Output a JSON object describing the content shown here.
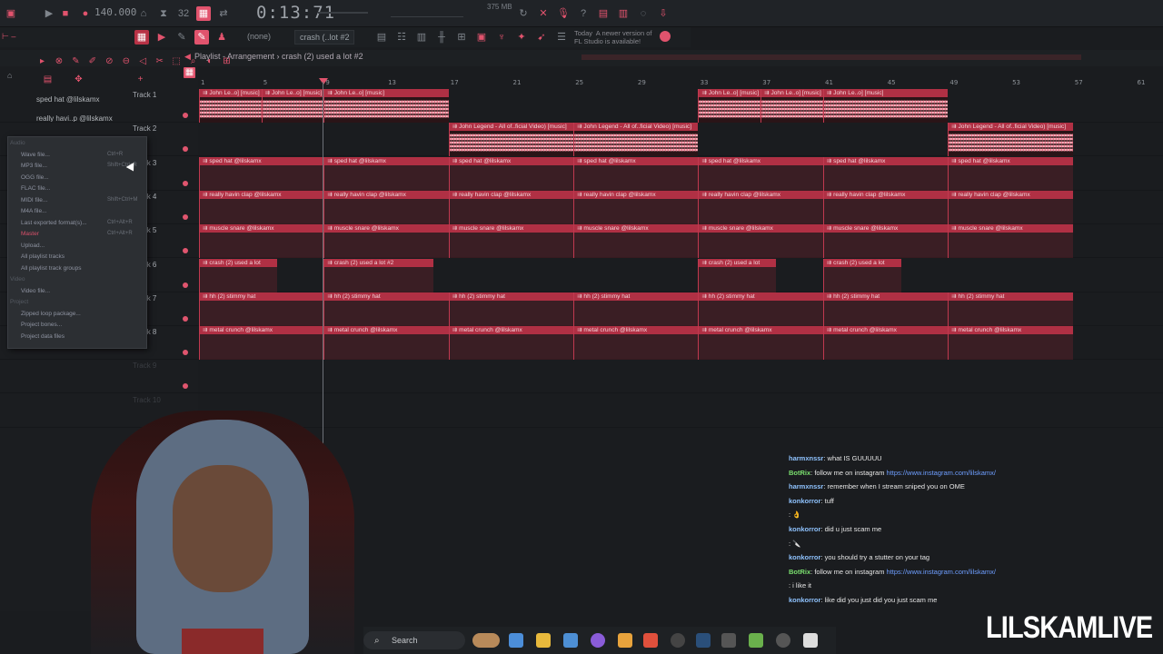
{
  "topbar": {
    "tempo": "140.000",
    "timecode": "0:13:71",
    "memory": "375 MB",
    "none_label": "(none)",
    "pattern_selector": "crash (..lot #2",
    "update_notice": "Today  A newer version of\nFL Studio is available!"
  },
  "playlist": {
    "title": "Playlist - Arrangement › crash (2) used a lot #2"
  },
  "browser": {
    "items": [
      "sped hat @lilskamx",
      "really havi..p @lilskamx"
    ]
  },
  "context_menu": {
    "items": [
      {
        "label": "Audio",
        "shortcut": "",
        "style": "header"
      },
      {
        "label": "Wave file...",
        "shortcut": "Ctrl+R"
      },
      {
        "label": "MP3 file...",
        "shortcut": "Shift+Ctrl+R"
      },
      {
        "label": "OGG file...",
        "shortcut": ""
      },
      {
        "label": "FLAC file...",
        "shortcut": ""
      },
      {
        "label": "MIDI file...",
        "shortcut": "Shift+Ctrl+M"
      },
      {
        "label": "M4A file...",
        "shortcut": ""
      },
      {
        "label": "Last exported format(s)...",
        "shortcut": "Ctrl+Alt+R"
      },
      {
        "label": "Master",
        "shortcut": "Ctrl+Alt+R",
        "style": "pink"
      },
      {
        "label": "Upload...",
        "shortcut": ""
      },
      {
        "label": "All playlist tracks",
        "shortcut": ""
      },
      {
        "label": "All playlist track groups",
        "shortcut": ""
      },
      {
        "label": "Video",
        "shortcut": "",
        "style": "header"
      },
      {
        "label": "Video file...",
        "shortcut": ""
      },
      {
        "label": "Project",
        "shortcut": "",
        "style": "header"
      },
      {
        "label": "Zipped loop package...",
        "shortcut": ""
      },
      {
        "label": "Project bones...",
        "shortcut": ""
      },
      {
        "label": "Project data files",
        "shortcut": ""
      }
    ]
  },
  "ruler": [
    "1",
    "5",
    "9",
    "13",
    "17",
    "21",
    "25",
    "29",
    "33",
    "37",
    "41",
    "45",
    "49",
    "53",
    "57",
    "61"
  ],
  "tracks": [
    {
      "label": "Track 1",
      "clips": [
        {
          "name": "John Le..o] [music]",
          "start": 0,
          "len": 4
        },
        {
          "name": "John Le..o] [music]",
          "start": 4,
          "len": 4
        },
        {
          "name": "John Le..o] [music]",
          "start": 8,
          "len": 8
        },
        {
          "name": "John Le..o] [music]",
          "start": 32,
          "len": 4
        },
        {
          "name": "John Le..o] [music]",
          "start": 36,
          "len": 4
        },
        {
          "name": "John Le..o] [music]",
          "start": 40,
          "len": 8
        }
      ],
      "audio": true
    },
    {
      "label": "Track 2",
      "clips": [
        {
          "name": "John Legend - All of..ficial Video) [music]",
          "start": 16,
          "len": 8
        },
        {
          "name": "John Legend - All of..ficial Video) [music]",
          "start": 24,
          "len": 8
        },
        {
          "name": "John Legend - All of..ficial Video) [music]",
          "start": 48,
          "len": 8
        }
      ],
      "audio": true
    },
    {
      "label": "Track 3",
      "clips": [
        {
          "name": "sped hat @lilskamx",
          "start": 0,
          "len": 8
        },
        {
          "name": "sped hat @lilskamx",
          "start": 8,
          "len": 8
        },
        {
          "name": "sped hat @lilskamx",
          "start": 16,
          "len": 8
        },
        {
          "name": "sped hat @lilskamx",
          "start": 24,
          "len": 8
        },
        {
          "name": "sped hat @lilskamx",
          "start": 32,
          "len": 8
        },
        {
          "name": "sped hat @lilskamx",
          "start": 40,
          "len": 8
        },
        {
          "name": "sped hat @lilskamx",
          "start": 48,
          "len": 8
        }
      ]
    },
    {
      "label": "Track 4",
      "clips": [
        {
          "name": "really havin clap @lilskamx",
          "start": 0,
          "len": 8
        },
        {
          "name": "really havin clap @lilskamx",
          "start": 8,
          "len": 8
        },
        {
          "name": "really havin clap @lilskamx",
          "start": 16,
          "len": 8
        },
        {
          "name": "really havin clap @lilskamx",
          "start": 24,
          "len": 8
        },
        {
          "name": "really havin clap @lilskamx",
          "start": 32,
          "len": 8
        },
        {
          "name": "really havin clap @lilskamx",
          "start": 40,
          "len": 8
        },
        {
          "name": "really havin clap @lilskamx",
          "start": 48,
          "len": 8
        }
      ]
    },
    {
      "label": "Track 5",
      "clips": [
        {
          "name": "muscle snare @lilskamx",
          "start": 0,
          "len": 8
        },
        {
          "name": "muscle snare @lilskamx",
          "start": 8,
          "len": 8
        },
        {
          "name": "muscle snare @lilskamx",
          "start": 16,
          "len": 8
        },
        {
          "name": "muscle snare @lilskamx",
          "start": 24,
          "len": 8
        },
        {
          "name": "muscle snare @lilskamx",
          "start": 32,
          "len": 8
        },
        {
          "name": "muscle snare @lilskamx",
          "start": 40,
          "len": 8
        },
        {
          "name": "muscle snare @lilskamx",
          "start": 48,
          "len": 8
        }
      ]
    },
    {
      "label": "Track 6",
      "clips": [
        {
          "name": "crash (2) used a lot",
          "start": 0,
          "len": 5
        },
        {
          "name": "crash (2) used a lot #2",
          "start": 8,
          "len": 7
        },
        {
          "name": "crash (2) used a lot",
          "start": 32,
          "len": 5
        },
        {
          "name": "crash (2) used a lot",
          "start": 40,
          "len": 5
        }
      ]
    },
    {
      "label": "Track 7",
      "clips": [
        {
          "name": "hh (2) stimmy hat",
          "start": 0,
          "len": 8
        },
        {
          "name": "hh (2) stimmy hat",
          "start": 8,
          "len": 8
        },
        {
          "name": "hh (2) stimmy hat",
          "start": 16,
          "len": 8
        },
        {
          "name": "hh (2) stimmy hat",
          "start": 24,
          "len": 8
        },
        {
          "name": "hh (2) stimmy hat",
          "start": 32,
          "len": 8
        },
        {
          "name": "hh (2) stimmy hat",
          "start": 40,
          "len": 8
        },
        {
          "name": "hh (2) stimmy hat",
          "start": 48,
          "len": 8
        }
      ]
    },
    {
      "label": "Track 8",
      "clips": [
        {
          "name": "metal crunch @lilskamx",
          "start": 0,
          "len": 8
        },
        {
          "name": "metal crunch @lilskamx",
          "start": 8,
          "len": 8
        },
        {
          "name": "metal crunch @lilskamx",
          "start": 16,
          "len": 8
        },
        {
          "name": "metal crunch @lilskamx",
          "start": 24,
          "len": 8
        },
        {
          "name": "metal crunch @lilskamx",
          "start": 32,
          "len": 8
        },
        {
          "name": "metal crunch @lilskamx",
          "start": 40,
          "len": 8
        },
        {
          "name": "metal crunch @lilskamx",
          "start": 48,
          "len": 8
        }
      ]
    },
    {
      "label": "Track 9",
      "clips": []
    },
    {
      "label": "Track 10",
      "clips": []
    }
  ],
  "chat": [
    {
      "user": "harmxnssr",
      "text": ": what IS GUUUUU",
      "type": "user"
    },
    {
      "user": "BotRix",
      "text": ": follow me on instagram ",
      "link": "https://www.instagram.com/lilskamx/",
      "type": "bot"
    },
    {
      "user": "harmxnssr",
      "text": ": remember when I stream sniped you on OME",
      "type": "user"
    },
    {
      "user": "konkorror",
      "text": ": tuff",
      "type": "user"
    },
    {
      "user": "",
      "text": ": 👌",
      "type": "user"
    },
    {
      "user": "konkorror",
      "text": ": did u just scam me",
      "type": "user"
    },
    {
      "user": "",
      "text": ": 🔪",
      "type": "user"
    },
    {
      "user": "konkorror",
      "text": ": you should try a stutter on your tag",
      "type": "user"
    },
    {
      "user": "BotRix",
      "text": ": follow me on instagram ",
      "link": "https://www.instagram.com/lilskamx/",
      "type": "bot"
    },
    {
      "user": "",
      "text": ": i like it",
      "type": "user"
    },
    {
      "user": "konkorror",
      "text": ": like did you just did you just scam me",
      "type": "user"
    }
  ],
  "taskbar": {
    "search": "Search"
  },
  "watermark": "LILSKAMLIVE",
  "colors": {
    "accent": "#e1536d",
    "clip": "#b03044",
    "bg": "#1a1c1f"
  }
}
